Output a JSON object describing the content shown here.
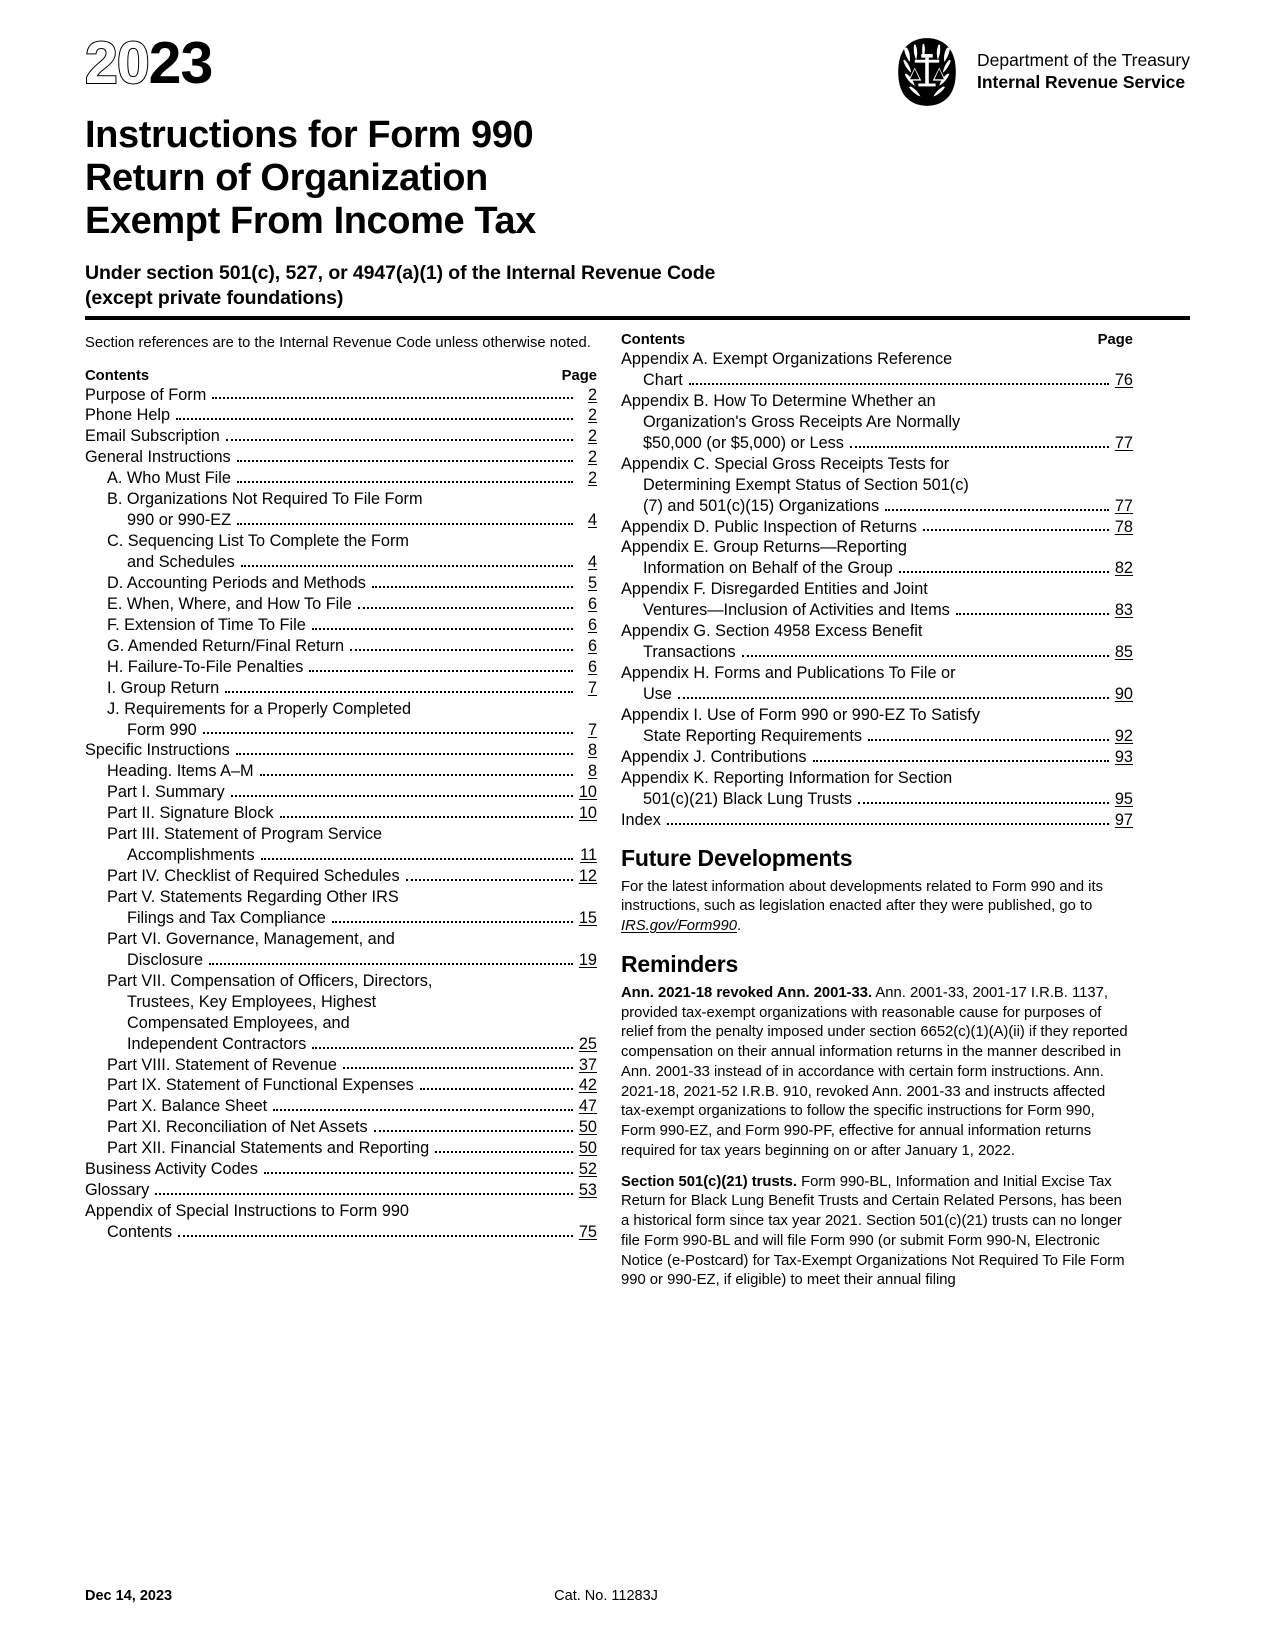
{
  "header": {
    "year_hollow": "20",
    "year_solid": "23",
    "title_line1": "Instructions for Form 990",
    "title_line2": "Return of Organization",
    "title_line3": "Exempt From Income Tax",
    "subtitle_line1": "Under section 501(c), 527, or 4947(a)(1) of the Internal Revenue Code",
    "subtitle_line2": "(except private foundations)",
    "agency_department": "Department of the Treasury",
    "agency_name": "Internal Revenue Service",
    "seal_icon": "irs-eagle-scales-seal-icon"
  },
  "left_column": {
    "intro_note": "Section references are to the Internal Revenue Code unless otherwise noted.",
    "toc_header": {
      "contents_label": "Contents",
      "page_label": "Page"
    },
    "toc": [
      {
        "text": "Purpose of Form",
        "page": "2",
        "indent": 0
      },
      {
        "text": "Phone Help",
        "page": "2",
        "indent": 0
      },
      {
        "text": "Email Subscription",
        "page": "2",
        "indent": 0
      },
      {
        "text": "General Instructions",
        "page": "2",
        "indent": 0
      },
      {
        "text": "A. Who Must File",
        "page": "2",
        "indent": 1
      },
      {
        "text": "B. Organizations Not Required To File Form",
        "page": "",
        "indent": 1,
        "wrap": true
      },
      {
        "text": "990 or 990-EZ",
        "page": "4",
        "indent": 2
      },
      {
        "text": "C. Sequencing List To Complete the Form",
        "page": "",
        "indent": 1,
        "wrap": true
      },
      {
        "text": "and Schedules",
        "page": "4",
        "indent": 2
      },
      {
        "text": "D. Accounting Periods and Methods",
        "page": "5",
        "indent": 1
      },
      {
        "text": "E. When, Where, and How To File",
        "page": "6",
        "indent": 1
      },
      {
        "text": "F. Extension of Time To File",
        "page": "6",
        "indent": 1
      },
      {
        "text": "G. Amended Return/Final Return",
        "page": "6",
        "indent": 1
      },
      {
        "text": "H. Failure-To-File Penalties",
        "page": "6",
        "indent": 1
      },
      {
        "text": "I. Group Return",
        "page": "7",
        "indent": 1
      },
      {
        "text": "J. Requirements for a Properly Completed",
        "page": "",
        "indent": 1,
        "wrap": true
      },
      {
        "text": "Form 990",
        "page": "7",
        "indent": 2
      },
      {
        "text": "Specific Instructions",
        "page": "8",
        "indent": 0
      },
      {
        "text": "Heading. Items A–M",
        "page": "8",
        "indent": 1
      },
      {
        "text": "Part I. Summary",
        "page": "10",
        "indent": 1
      },
      {
        "text": "Part II. Signature Block",
        "page": "10",
        "indent": 1
      },
      {
        "text": "Part III. Statement of Program Service",
        "page": "",
        "indent": 1,
        "wrap": true
      },
      {
        "text": "Accomplishments",
        "page": "11",
        "indent": 2
      },
      {
        "text": "Part IV. Checklist of Required Schedules",
        "page": "12",
        "indent": 1
      },
      {
        "text": "Part V. Statements Regarding Other IRS",
        "page": "",
        "indent": 1,
        "wrap": true
      },
      {
        "text": "Filings and Tax Compliance",
        "page": "15",
        "indent": 2
      },
      {
        "text": "Part VI. Governance, Management, and",
        "page": "",
        "indent": 1,
        "wrap": true
      },
      {
        "text": "Disclosure",
        "page": "19",
        "indent": 2
      },
      {
        "text": "Part VII. Compensation of Officers, Directors,",
        "page": "",
        "indent": 1,
        "wrap": true
      },
      {
        "text": "Trustees, Key Employees, Highest",
        "page": "",
        "indent": 2,
        "wrap": true
      },
      {
        "text": "Compensated Employees, and",
        "page": "",
        "indent": 2,
        "wrap": true
      },
      {
        "text": "Independent Contractors",
        "page": "25",
        "indent": 2
      },
      {
        "text": "Part VIII. Statement of Revenue",
        "page": "37",
        "indent": 1
      },
      {
        "text": "Part IX. Statement of Functional Expenses",
        "page": "42",
        "indent": 1
      },
      {
        "text": "Part X. Balance Sheet",
        "page": "47",
        "indent": 1
      },
      {
        "text": "Part XI. Reconciliation of Net Assets",
        "page": "50",
        "indent": 1
      },
      {
        "text": "Part XII. Financial Statements and Reporting",
        "page": "50",
        "indent": 1
      },
      {
        "text": "Business Activity Codes",
        "page": "52",
        "indent": 0
      },
      {
        "text": "Glossary",
        "page": "53",
        "indent": 0
      },
      {
        "text": "Appendix of Special Instructions to Form 990",
        "page": "",
        "indent": 0,
        "wrap": true
      },
      {
        "text": "Contents",
        "page": "75",
        "indent": 1
      }
    ]
  },
  "right_column": {
    "toc_header": {
      "contents_label": "Contents",
      "page_label": "Page"
    },
    "toc": [
      {
        "text": "Appendix A. Exempt Organizations Reference",
        "page": "",
        "indent": 0,
        "wrap": true
      },
      {
        "text": "Chart",
        "page": "76",
        "indent": 1
      },
      {
        "text": "Appendix B. How To Determine Whether an",
        "page": "",
        "indent": 0,
        "wrap": true
      },
      {
        "text": "Organization's Gross Receipts Are Normally",
        "page": "",
        "indent": 1,
        "wrap": true
      },
      {
        "text": "$50,000 (or $5,000) or Less",
        "page": "77",
        "indent": 1
      },
      {
        "text": "Appendix C. Special Gross Receipts Tests for",
        "page": "",
        "indent": 0,
        "wrap": true
      },
      {
        "text": "Determining Exempt Status of Section 501(c)",
        "page": "",
        "indent": 1,
        "wrap": true
      },
      {
        "text": "(7) and 501(c)(15) Organizations",
        "page": "77",
        "indent": 1
      },
      {
        "text": "Appendix D. Public Inspection of Returns",
        "page": "78",
        "indent": 0
      },
      {
        "text": "Appendix E. Group Returns—Reporting",
        "page": "",
        "indent": 0,
        "wrap": true
      },
      {
        "text": "Information on Behalf of the Group",
        "page": "82",
        "indent": 1
      },
      {
        "text": "Appendix F. Disregarded Entities and Joint",
        "page": "",
        "indent": 0,
        "wrap": true
      },
      {
        "text": "Ventures—Inclusion of Activities and Items",
        "page": "83",
        "indent": 1
      },
      {
        "text": "Appendix G. Section 4958 Excess Benefit",
        "page": "",
        "indent": 0,
        "wrap": true
      },
      {
        "text": "Transactions",
        "page": "85",
        "indent": 1
      },
      {
        "text": "Appendix H. Forms and Publications To File or",
        "page": "",
        "indent": 0,
        "wrap": true
      },
      {
        "text": "Use",
        "page": "90",
        "indent": 1
      },
      {
        "text": "Appendix I. Use of Form 990 or 990-EZ To Satisfy",
        "page": "",
        "indent": 0,
        "wrap": true
      },
      {
        "text": "State Reporting Requirements",
        "page": "92",
        "indent": 1
      },
      {
        "text": "Appendix J. Contributions",
        "page": "93",
        "indent": 0
      },
      {
        "text": "Appendix K. Reporting Information for Section",
        "page": "",
        "indent": 0,
        "wrap": true
      },
      {
        "text": "501(c)(21) Black Lung Trusts",
        "page": "95",
        "indent": 1
      },
      {
        "text": "Index",
        "page": "97",
        "indent": 0
      }
    ],
    "future_developments": {
      "heading": "Future Developments",
      "body_before_link": "For the latest information about developments related to Form 990 and its instructions, such as legislation enacted after they were published, go to ",
      "link_text": "IRS.gov/Form990",
      "body_after_link": "."
    },
    "reminders": {
      "heading": "Reminders",
      "items": [
        {
          "lead": "Ann. 2021-18 revoked Ann. 2001-33.",
          "body": " Ann. 2001-33, 2001-17 I.R.B. 1137, provided tax-exempt organizations with reasonable cause for purposes of relief from the penalty imposed under section 6652(c)(1)(A)(ii) if they reported compensation on their annual information returns in the manner described in Ann. 2001-33 instead of in accordance with certain form instructions. Ann. 2021-18, 2021-52 I.R.B. 910, revoked Ann. 2001-33 and instructs affected tax-exempt organizations to follow the specific instructions for Form 990, Form 990-EZ, and Form 990-PF, effective for annual information returns required for tax years beginning on or after January 1, 2022."
        },
        {
          "lead": "Section 501(c)(21) trusts.",
          "body": " Form 990-BL, Information and Initial Excise Tax Return for Black Lung Benefit Trusts and Certain Related Persons, has been a historical form since tax year 2021. Section 501(c)(21) trusts can no longer file Form 990-BL and will file Form 990 (or submit Form 990-N, Electronic Notice (e-Postcard) for Tax-Exempt Organizations Not Required To File Form 990 or 990-EZ, if eligible) to meet their annual filing"
        }
      ]
    }
  },
  "footer": {
    "date": "Dec 14, 2023",
    "catalog": "Cat. No. 11283J"
  }
}
